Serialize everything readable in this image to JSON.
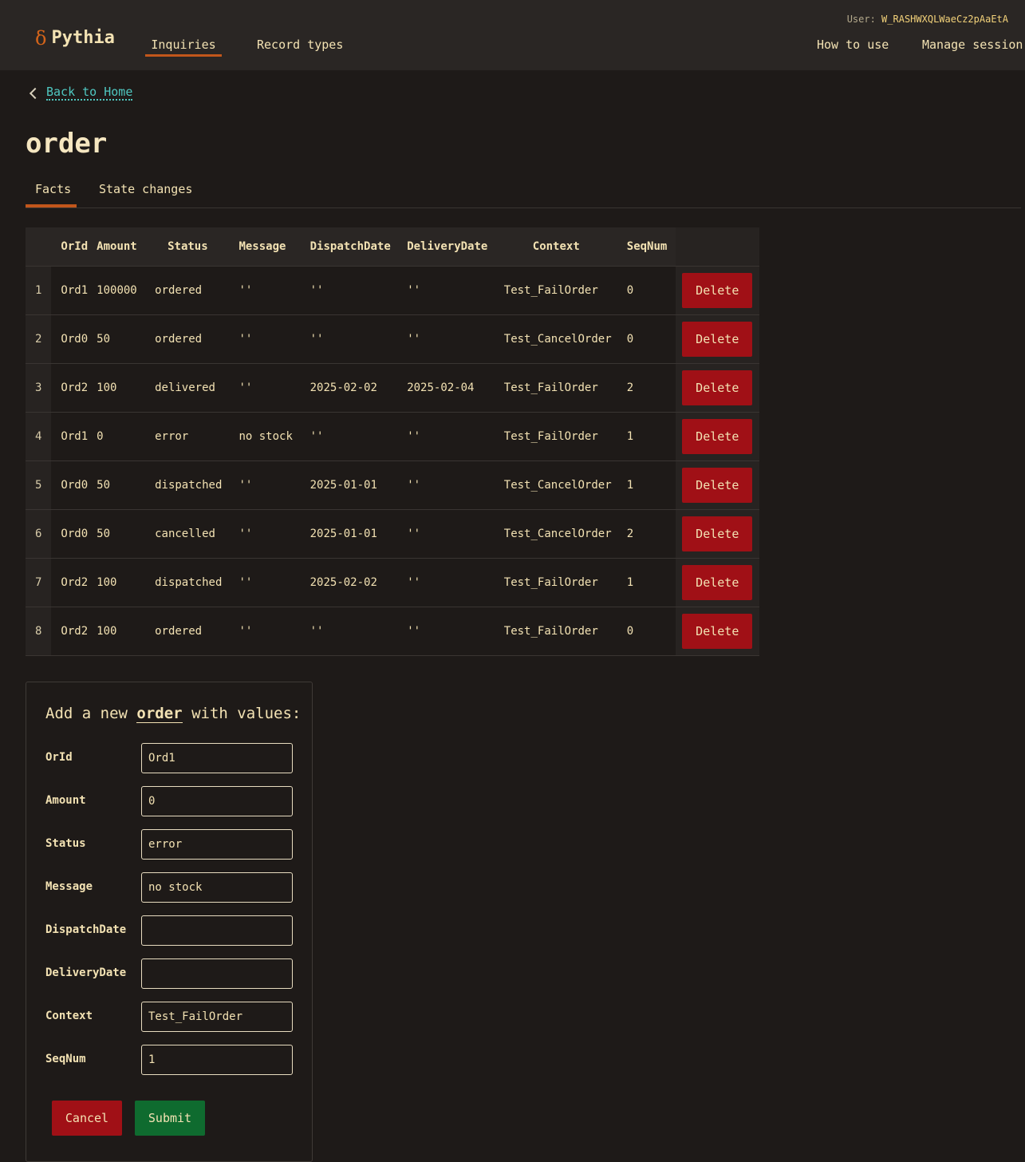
{
  "header": {
    "brand_symbol": "δ",
    "brand_name": "Pythia",
    "nav": {
      "inquiries": "Inquiries",
      "record_types": "Record types",
      "how_to_use": "How to use",
      "manage_session": "Manage session"
    },
    "user_label": "User:",
    "user_id": "W_RASHWXQLWaeCz2pAaEtA"
  },
  "back_link": "Back to Home",
  "page_title": "order",
  "tabs": {
    "facts": "Facts",
    "state_changes": "State changes"
  },
  "table": {
    "columns": [
      "OrId",
      "Amount",
      "Status",
      "Message",
      "DispatchDate",
      "DeliveryDate",
      "Context",
      "SeqNum"
    ],
    "delete_label": "Delete",
    "rows": [
      {
        "idx": "1",
        "OrId": "Ord1",
        "Amount": "100000",
        "Status": "ordered",
        "Message": "''",
        "DispatchDate": "''",
        "DeliveryDate": "''",
        "Context": "Test_FailOrder",
        "SeqNum": "0"
      },
      {
        "idx": "2",
        "OrId": "Ord0",
        "Amount": "50",
        "Status": "ordered",
        "Message": "''",
        "DispatchDate": "''",
        "DeliveryDate": "''",
        "Context": "Test_CancelOrder",
        "SeqNum": "0"
      },
      {
        "idx": "3",
        "OrId": "Ord2",
        "Amount": "100",
        "Status": "delivered",
        "Message": "''",
        "DispatchDate": "2025-02-02",
        "DeliveryDate": "2025-02-04",
        "Context": "Test_FailOrder",
        "SeqNum": "2"
      },
      {
        "idx": "4",
        "OrId": "Ord1",
        "Amount": "0",
        "Status": "error",
        "Message": "no stock",
        "DispatchDate": "''",
        "DeliveryDate": "''",
        "Context": "Test_FailOrder",
        "SeqNum": "1"
      },
      {
        "idx": "5",
        "OrId": "Ord0",
        "Amount": "50",
        "Status": "dispatched",
        "Message": "''",
        "DispatchDate": "2025-01-01",
        "DeliveryDate": "''",
        "Context": "Test_CancelOrder",
        "SeqNum": "1"
      },
      {
        "idx": "6",
        "OrId": "Ord0",
        "Amount": "50",
        "Status": "cancelled",
        "Message": "''",
        "DispatchDate": "2025-01-01",
        "DeliveryDate": "''",
        "Context": "Test_CancelOrder",
        "SeqNum": "2"
      },
      {
        "idx": "7",
        "OrId": "Ord2",
        "Amount": "100",
        "Status": "dispatched",
        "Message": "''",
        "DispatchDate": "2025-02-02",
        "DeliveryDate": "''",
        "Context": "Test_FailOrder",
        "SeqNum": "1"
      },
      {
        "idx": "8",
        "OrId": "Ord2",
        "Amount": "100",
        "Status": "ordered",
        "Message": "''",
        "DispatchDate": "''",
        "DeliveryDate": "''",
        "Context": "Test_FailOrder",
        "SeqNum": "0"
      }
    ]
  },
  "form": {
    "title_prefix": "Add a new",
    "entity": "order",
    "title_suffix": "with values:",
    "fields": [
      {
        "label": "OrId",
        "value": "Ord1"
      },
      {
        "label": "Amount",
        "value": "0"
      },
      {
        "label": "Status",
        "value": "error"
      },
      {
        "label": "Message",
        "value": "no stock"
      },
      {
        "label": "DispatchDate",
        "value": ""
      },
      {
        "label": "DeliveryDate",
        "value": ""
      },
      {
        "label": "Context",
        "value": "Test_FailOrder"
      },
      {
        "label": "SeqNum",
        "value": "1"
      }
    ],
    "cancel_label": "Cancel",
    "submit_label": "Submit"
  },
  "colors": {
    "background": "#1e1a18",
    "header_bg": "#2a2624",
    "text": "#f3e2b3",
    "accent": "#c2561b",
    "link": "#4fc7c0",
    "danger": "#a01016",
    "success": "#0f6b2f"
  }
}
